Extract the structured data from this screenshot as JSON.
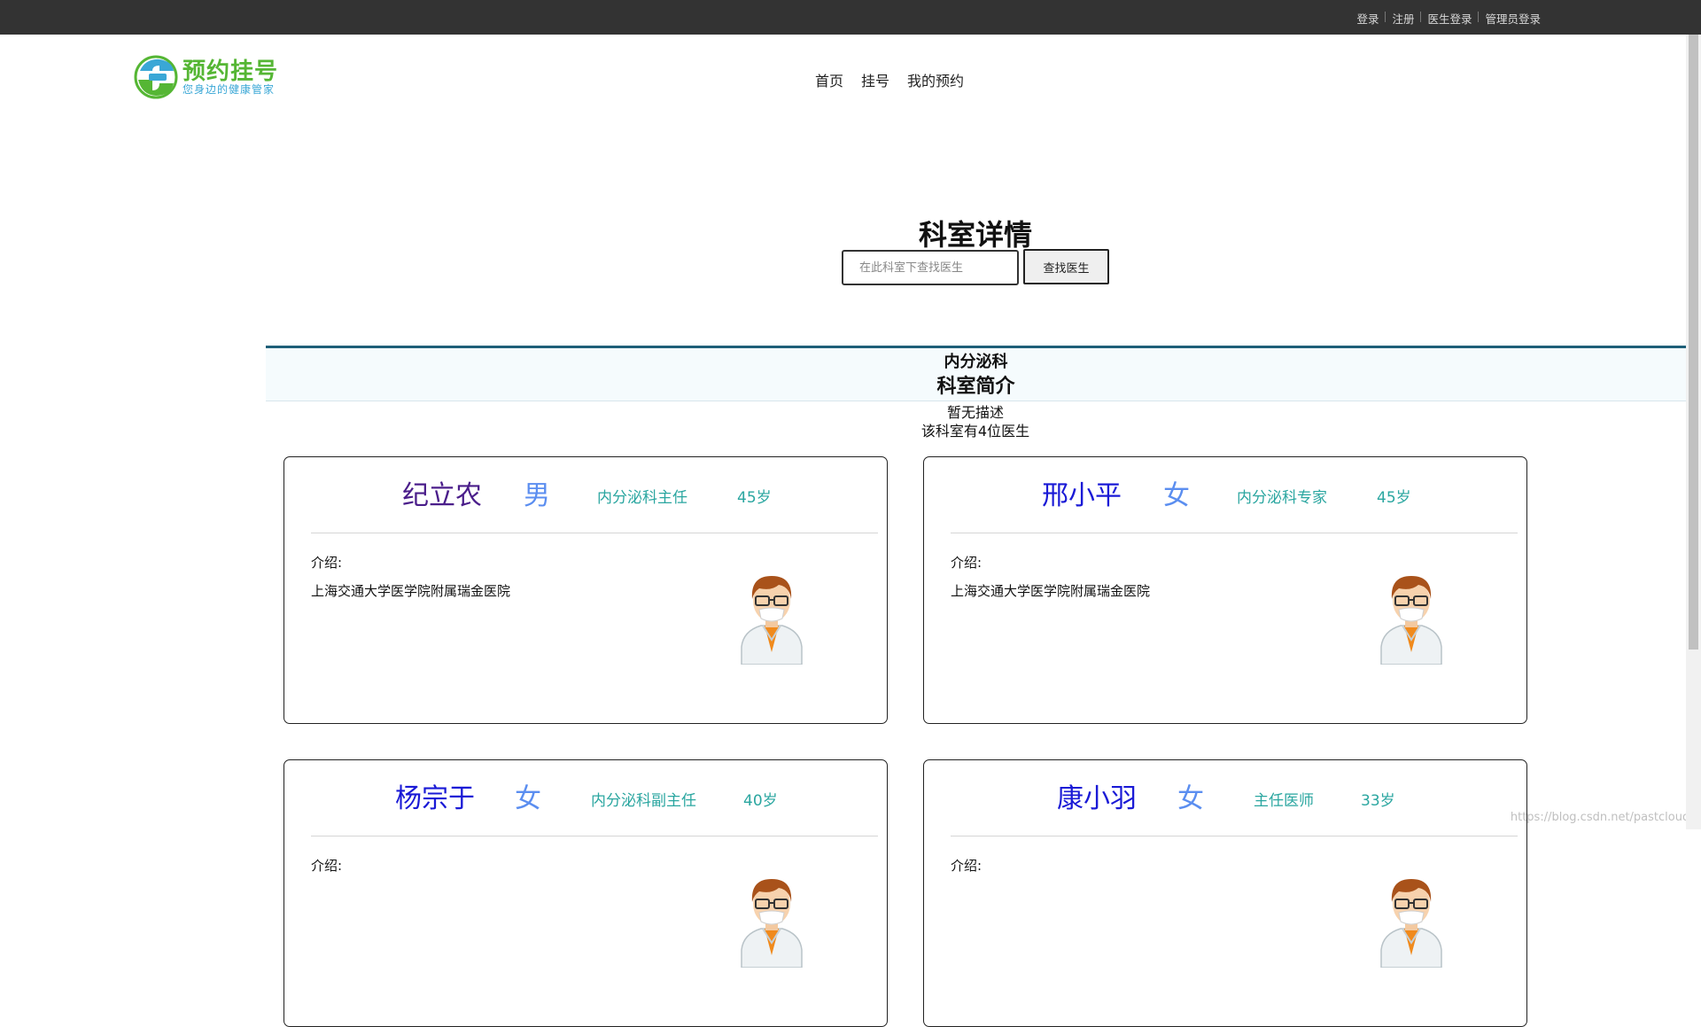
{
  "topbar": {
    "links": [
      "登录",
      "注册",
      "医生登录",
      "管理员登录"
    ]
  },
  "logo": {
    "title": "预约挂号",
    "subtitle": "您身边的健康管家"
  },
  "nav": [
    "首页",
    "挂号",
    "我的预约"
  ],
  "page": {
    "title": "科室详情",
    "search_placeholder": "在此科室下查找医生",
    "search_button": "查找医生"
  },
  "department": {
    "name": "内分泌科",
    "intro_title": "科室简介",
    "description": "暂无描述",
    "doctor_count_text": "该科室有4位医生"
  },
  "doctors": [
    {
      "name": "纪立农",
      "sex": "男",
      "title": "内分泌科主任",
      "age": "45岁",
      "intro_label": "介绍:",
      "intro": "上海交通大学医学院附属瑞金医院",
      "name_color": "#4a1d8a"
    },
    {
      "name": "邢小平",
      "sex": "女",
      "title": "内分泌科专家",
      "age": "45岁",
      "intro_label": "介绍:",
      "intro": "上海交通大学医学院附属瑞金医院",
      "name_color": "#1a1ad6"
    },
    {
      "name": "杨宗于",
      "sex": "女",
      "title": "内分泌科副主任",
      "age": "40岁",
      "intro_label": "介绍:",
      "intro": "",
      "name_color": "#1a1ad6"
    },
    {
      "name": "康小羽",
      "sex": "女",
      "title": "主任医师",
      "age": "33岁",
      "intro_label": "介绍:",
      "intro": "",
      "name_color": "#1a1ad6"
    }
  ],
  "watermark": "https://blog.csdn.net/pastclouds",
  "colors": {
    "topbar_bg": "#333333",
    "accent_teal": "#2aa6a0",
    "sex_blue": "#5b8ef0",
    "logo_green": "#55b634",
    "logo_blue": "#3aa7d6"
  }
}
